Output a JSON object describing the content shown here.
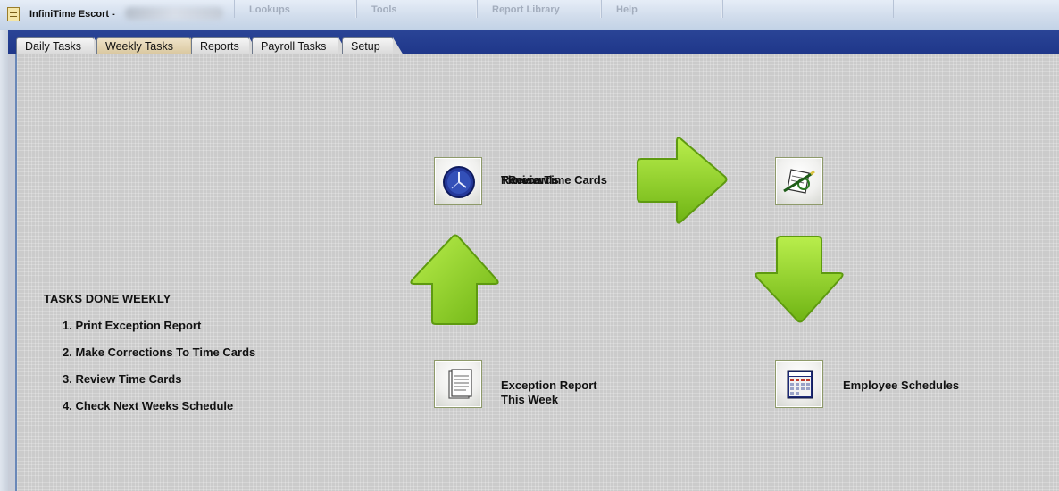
{
  "window": {
    "title": "InfiniTime Escort -",
    "menu": [
      "Lookups",
      "Tools",
      "Report Library",
      "Help"
    ]
  },
  "tabs": [
    "Daily Tasks",
    "Weekly Tasks",
    "Reports",
    "Payroll Tasks",
    "Setup"
  ],
  "active_tab": "Weekly Tasks",
  "tasks": {
    "title": "TASKS DONE WEEKLY",
    "items": [
      "1. Print Exception Report",
      "2. Make Corrections To Time Cards",
      "3. Review Time Cards",
      "4. Check Next Weeks Schedule"
    ]
  },
  "workflow": {
    "review_label": "Review Time Cards",
    "overlap_label_1": "Timecards",
    "overlap_label_2": "Review",
    "exception_label_line1": "Exception Report",
    "exception_label_line2": "This Week",
    "schedules_label": "Employee Schedules"
  },
  "colors": {
    "tab_strip": "#22398c",
    "arrow_green": "#8fd21c",
    "panel_bg": "#cbcbcb"
  },
  "icons": {
    "timecard_tile": "clock-icon",
    "review_tile": "review-pen-icon",
    "exception_tile": "document-icon",
    "schedules_tile": "calendar-icon"
  }
}
